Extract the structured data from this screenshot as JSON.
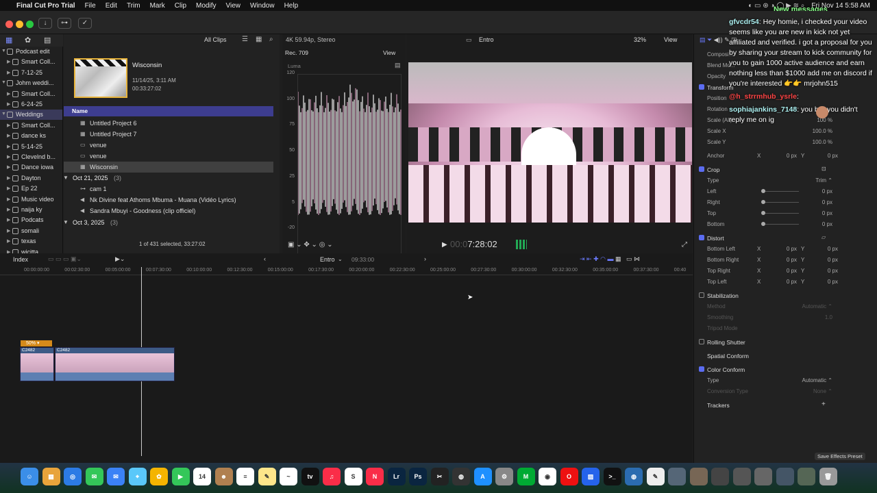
{
  "menubar": {
    "app": "Final Cut Pro Trial",
    "items": [
      "File",
      "Edit",
      "Trim",
      "Mark",
      "Clip",
      "Modify",
      "View",
      "Window",
      "Help"
    ],
    "clock": "Fri Nov 14  5:58 AM",
    "new_messages": "New messages"
  },
  "browser": {
    "filter": "All Clips",
    "clip_title": "Wisconsin",
    "clip_date": "11/14/25, 3:11 AM",
    "clip_duration": "00:33:27:02",
    "name_header": "Name",
    "rows": [
      {
        "label": "Untitled Project 6",
        "type": "project"
      },
      {
        "label": "Untitled Project 7",
        "type": "project"
      },
      {
        "label": "venue",
        "type": "clip"
      },
      {
        "label": "venue",
        "type": "clip"
      },
      {
        "label": "Wisconsin",
        "type": "project",
        "selected": true
      }
    ],
    "group1": "Oct 21, 2025",
    "group1_count": "(3)",
    "group1_rows": [
      "cam 1",
      "Nk Divine feat Athoms Mbuma - Muana (Vidéo Lyrics)",
      "Sandra Mbuyi - Goodness (clip officiel)"
    ],
    "group2": "Oct 3, 2025",
    "group2_count": "(3)",
    "status": "1 of 431 selected, 33:27:02"
  },
  "sidebar": {
    "items": [
      {
        "label": "Podcast edit",
        "level": 0,
        "tri": "▼"
      },
      {
        "label": "Smart Coll...",
        "level": 1,
        "tri": "▶"
      },
      {
        "label": "7-12-25",
        "level": 1,
        "tri": "▶"
      },
      {
        "label": "Johm weddi...",
        "level": 0,
        "tri": "▼"
      },
      {
        "label": "Smart Coll...",
        "level": 1,
        "tri": "▶"
      },
      {
        "label": "6-24-25",
        "level": 1,
        "tri": "▶"
      },
      {
        "label": "Weddings",
        "level": 0,
        "tri": "▼",
        "selected": true
      },
      {
        "label": "Smart Coll...",
        "level": 1,
        "tri": "▶"
      },
      {
        "label": "dance ks",
        "level": 1,
        "tri": "▶"
      },
      {
        "label": "5-14-25",
        "level": 1,
        "tri": "▶"
      },
      {
        "label": "Clevelnd b...",
        "level": 1,
        "tri": "▶"
      },
      {
        "label": "Dance  iowa",
        "level": 1,
        "tri": "▶"
      },
      {
        "label": "Dayton",
        "level": 1,
        "tri": "▶"
      },
      {
        "label": "Ep 22",
        "level": 1,
        "tri": "▶"
      },
      {
        "label": "Music video",
        "level": 1,
        "tri": "▶"
      },
      {
        "label": "naija ky",
        "level": 1,
        "tri": "▶"
      },
      {
        "label": "Podcats",
        "level": 1,
        "tri": "▶"
      },
      {
        "label": "somali",
        "level": 1,
        "tri": "▶"
      },
      {
        "label": "texas",
        "level": 1,
        "tri": "▶"
      },
      {
        "label": "wicitta",
        "level": 1,
        "tri": "▶"
      }
    ]
  },
  "scope": {
    "format": "4K 59.94p, Stereo",
    "colorspace": "Rec. 709",
    "view": "View",
    "mode": "Luma",
    "scale": [
      "120",
      "100",
      "75",
      "50",
      "25",
      "5",
      "-20"
    ]
  },
  "viewer": {
    "project": "Entro",
    "zoom": "32%",
    "view": "View",
    "timecode_dim": "00:0",
    "timecode": "7:28:02"
  },
  "timeline": {
    "index": "Index",
    "project": "Entro",
    "duration": "09:33:00",
    "ticks": [
      "00:00:00:00",
      "00:02:30:00",
      "00:05:00:00",
      "00:07:30:00",
      "00:10:00:00",
      "00:12:30:00",
      "00:15:00:00",
      "00:17:30:00",
      "00:20:00:00",
      "00:22:30:00",
      "00:25:00:00",
      "00:27:30:00",
      "00:30:00:00",
      "00:32:30:00",
      "00:35:00:00",
      "00:37:30:00",
      "00:40"
    ],
    "speed_badge": "50% ▾",
    "clip1": "C2482",
    "clip2": "C2482"
  },
  "inspector": {
    "rows_top": [
      {
        "label": "Composi..."
      },
      {
        "label": "Blend Mo..."
      },
      {
        "label": "Opacity"
      },
      {
        "label": "Transform",
        "section": true
      },
      {
        "label": "Position"
      },
      {
        "label": "Rotation"
      },
      {
        "label": "Scale (All)",
        "value": "100 %"
      },
      {
        "label": "Scale X",
        "value": "100.0 %"
      },
      {
        "label": "Scale Y",
        "value": "100.0 %"
      }
    ],
    "anchor": {
      "label": "Anchor",
      "x": "X",
      "xv": "0 px",
      "y": "Y",
      "yv": "0 px"
    },
    "crop": "Crop",
    "crop_type": "Type",
    "crop_type_val": "Trim ⌃",
    "crop_rows": [
      {
        "label": "Left",
        "value": "0 px"
      },
      {
        "label": "Right",
        "value": "0 px"
      },
      {
        "label": "Top",
        "value": "0 px"
      },
      {
        "label": "Bottom",
        "value": "0 px"
      }
    ],
    "distort": "Distort",
    "distort_rows": [
      {
        "label": "Bottom Left",
        "x": "X",
        "xv": "0 px",
        "y": "Y",
        "yv": "0 px"
      },
      {
        "label": "Bottom Right",
        "x": "X",
        "xv": "0 px",
        "y": "Y",
        "yv": "0 px"
      },
      {
        "label": "Top Right",
        "x": "X",
        "xv": "0 px",
        "y": "Y",
        "yv": "0 px"
      },
      {
        "label": "Top Left",
        "x": "X",
        "xv": "0 px",
        "y": "Y",
        "yv": "0 px"
      }
    ],
    "stabilization": "Stabilization",
    "stab_method": "Method",
    "stab_method_val": "Automatic ⌃",
    "stab_smoothing": "Smoothing",
    "stab_smoothing_val": "1.0",
    "stab_tripod": "Tripod Mode",
    "rolling": "Rolling Shutter",
    "spatial": "Spatial Conform",
    "color_conform": "Color Conform",
    "cc_type": "Type",
    "cc_type_val": "Automatic ⌃",
    "cc_conv": "Conversion Type",
    "cc_conv_val": "None ⌃",
    "trackers": "Trackers",
    "trackers_add": "+",
    "save_preset": "Save Effects Preset"
  },
  "chat": [
    {
      "user": "gfvcdr54",
      "text": ": Hey homie, i checked your video seems like you are new in kick not yet affiliated and verified. i got a proposal for you by sharing your stream to kick community for you to gain 1000 active audience and earn nothing less than $1000 add me on discord if you're interested 👉👉 mrjohn515"
    },
    {
      "user": "@h_strrmhub_ysrle",
      "text": ":"
    },
    {
      "user": "sophiajankins_7148",
      "text": ": you bro you didn't reply me on ig"
    }
  ],
  "dock": [
    {
      "name": "finder",
      "color": "#3b8ee8",
      "glyph": "☺"
    },
    {
      "name": "launchpad",
      "color": "#e8a43b",
      "glyph": "▦"
    },
    {
      "name": "safari",
      "color": "#2c7be5",
      "glyph": "◎"
    },
    {
      "name": "messages",
      "color": "#34c759",
      "glyph": "✉"
    },
    {
      "name": "mail",
      "color": "#3b82f6",
      "glyph": "✉"
    },
    {
      "name": "maps",
      "color": "#5ac8fa",
      "glyph": "⌖"
    },
    {
      "name": "photos",
      "color": "#f4b400",
      "glyph": "✿"
    },
    {
      "name": "facetime",
      "color": "#34c759",
      "glyph": "▶"
    },
    {
      "name": "calendar",
      "color": "#ffffff",
      "glyph": "14"
    },
    {
      "name": "contacts",
      "color": "#b08050",
      "glyph": "☻"
    },
    {
      "name": "reminders",
      "color": "#ffffff",
      "glyph": "≡"
    },
    {
      "name": "notes",
      "color": "#fde68a",
      "glyph": "✎"
    },
    {
      "name": "freeform",
      "color": "#ffffff",
      "glyph": "~"
    },
    {
      "name": "tv",
      "color": "#111111",
      "glyph": "tv"
    },
    {
      "name": "music",
      "color": "#fa2d48",
      "glyph": "♫"
    },
    {
      "name": "skype",
      "color": "#ffffff",
      "glyph": "S"
    },
    {
      "name": "news",
      "color": "#fa2d48",
      "glyph": "N"
    },
    {
      "name": "lightroom",
      "color": "#0a2540",
      "glyph": "Lr"
    },
    {
      "name": "photoshop",
      "color": "#0a2540",
      "glyph": "Ps"
    },
    {
      "name": "final-cut",
      "color": "#222222",
      "glyph": "✂"
    },
    {
      "name": "davinci",
      "color": "#333333",
      "glyph": "◍"
    },
    {
      "name": "app-store",
      "color": "#1e90ff",
      "glyph": "A"
    },
    {
      "name": "system-settings",
      "color": "#888888",
      "glyph": "⚙"
    },
    {
      "name": "motion",
      "color": "#0a3",
      "glyph": "M"
    },
    {
      "name": "chrome",
      "color": "#ffffff",
      "glyph": "◉"
    },
    {
      "name": "opera",
      "color": "#e11",
      "glyph": "O"
    },
    {
      "name": "pattern-app",
      "color": "#2563eb",
      "glyph": "▨"
    },
    {
      "name": "terminal",
      "color": "#111111",
      "glyph": ">_"
    },
    {
      "name": "app-1",
      "color": "#2b6cb0",
      "glyph": "◍"
    },
    {
      "name": "textedit",
      "color": "#eeeeee",
      "glyph": "✎"
    },
    {
      "name": "thumb-1",
      "color": "#556677",
      "glyph": ""
    },
    {
      "name": "thumb-2",
      "color": "#776655",
      "glyph": ""
    },
    {
      "name": "thumb-3",
      "color": "#444444",
      "glyph": ""
    },
    {
      "name": "thumb-4",
      "color": "#555555",
      "glyph": ""
    },
    {
      "name": "thumb-5",
      "color": "#666666",
      "glyph": ""
    },
    {
      "name": "thumb-6",
      "color": "#445566",
      "glyph": ""
    },
    {
      "name": "thumb-7",
      "color": "#556655",
      "glyph": ""
    },
    {
      "name": "trash",
      "color": "#999999",
      "glyph": "🗑"
    }
  ]
}
